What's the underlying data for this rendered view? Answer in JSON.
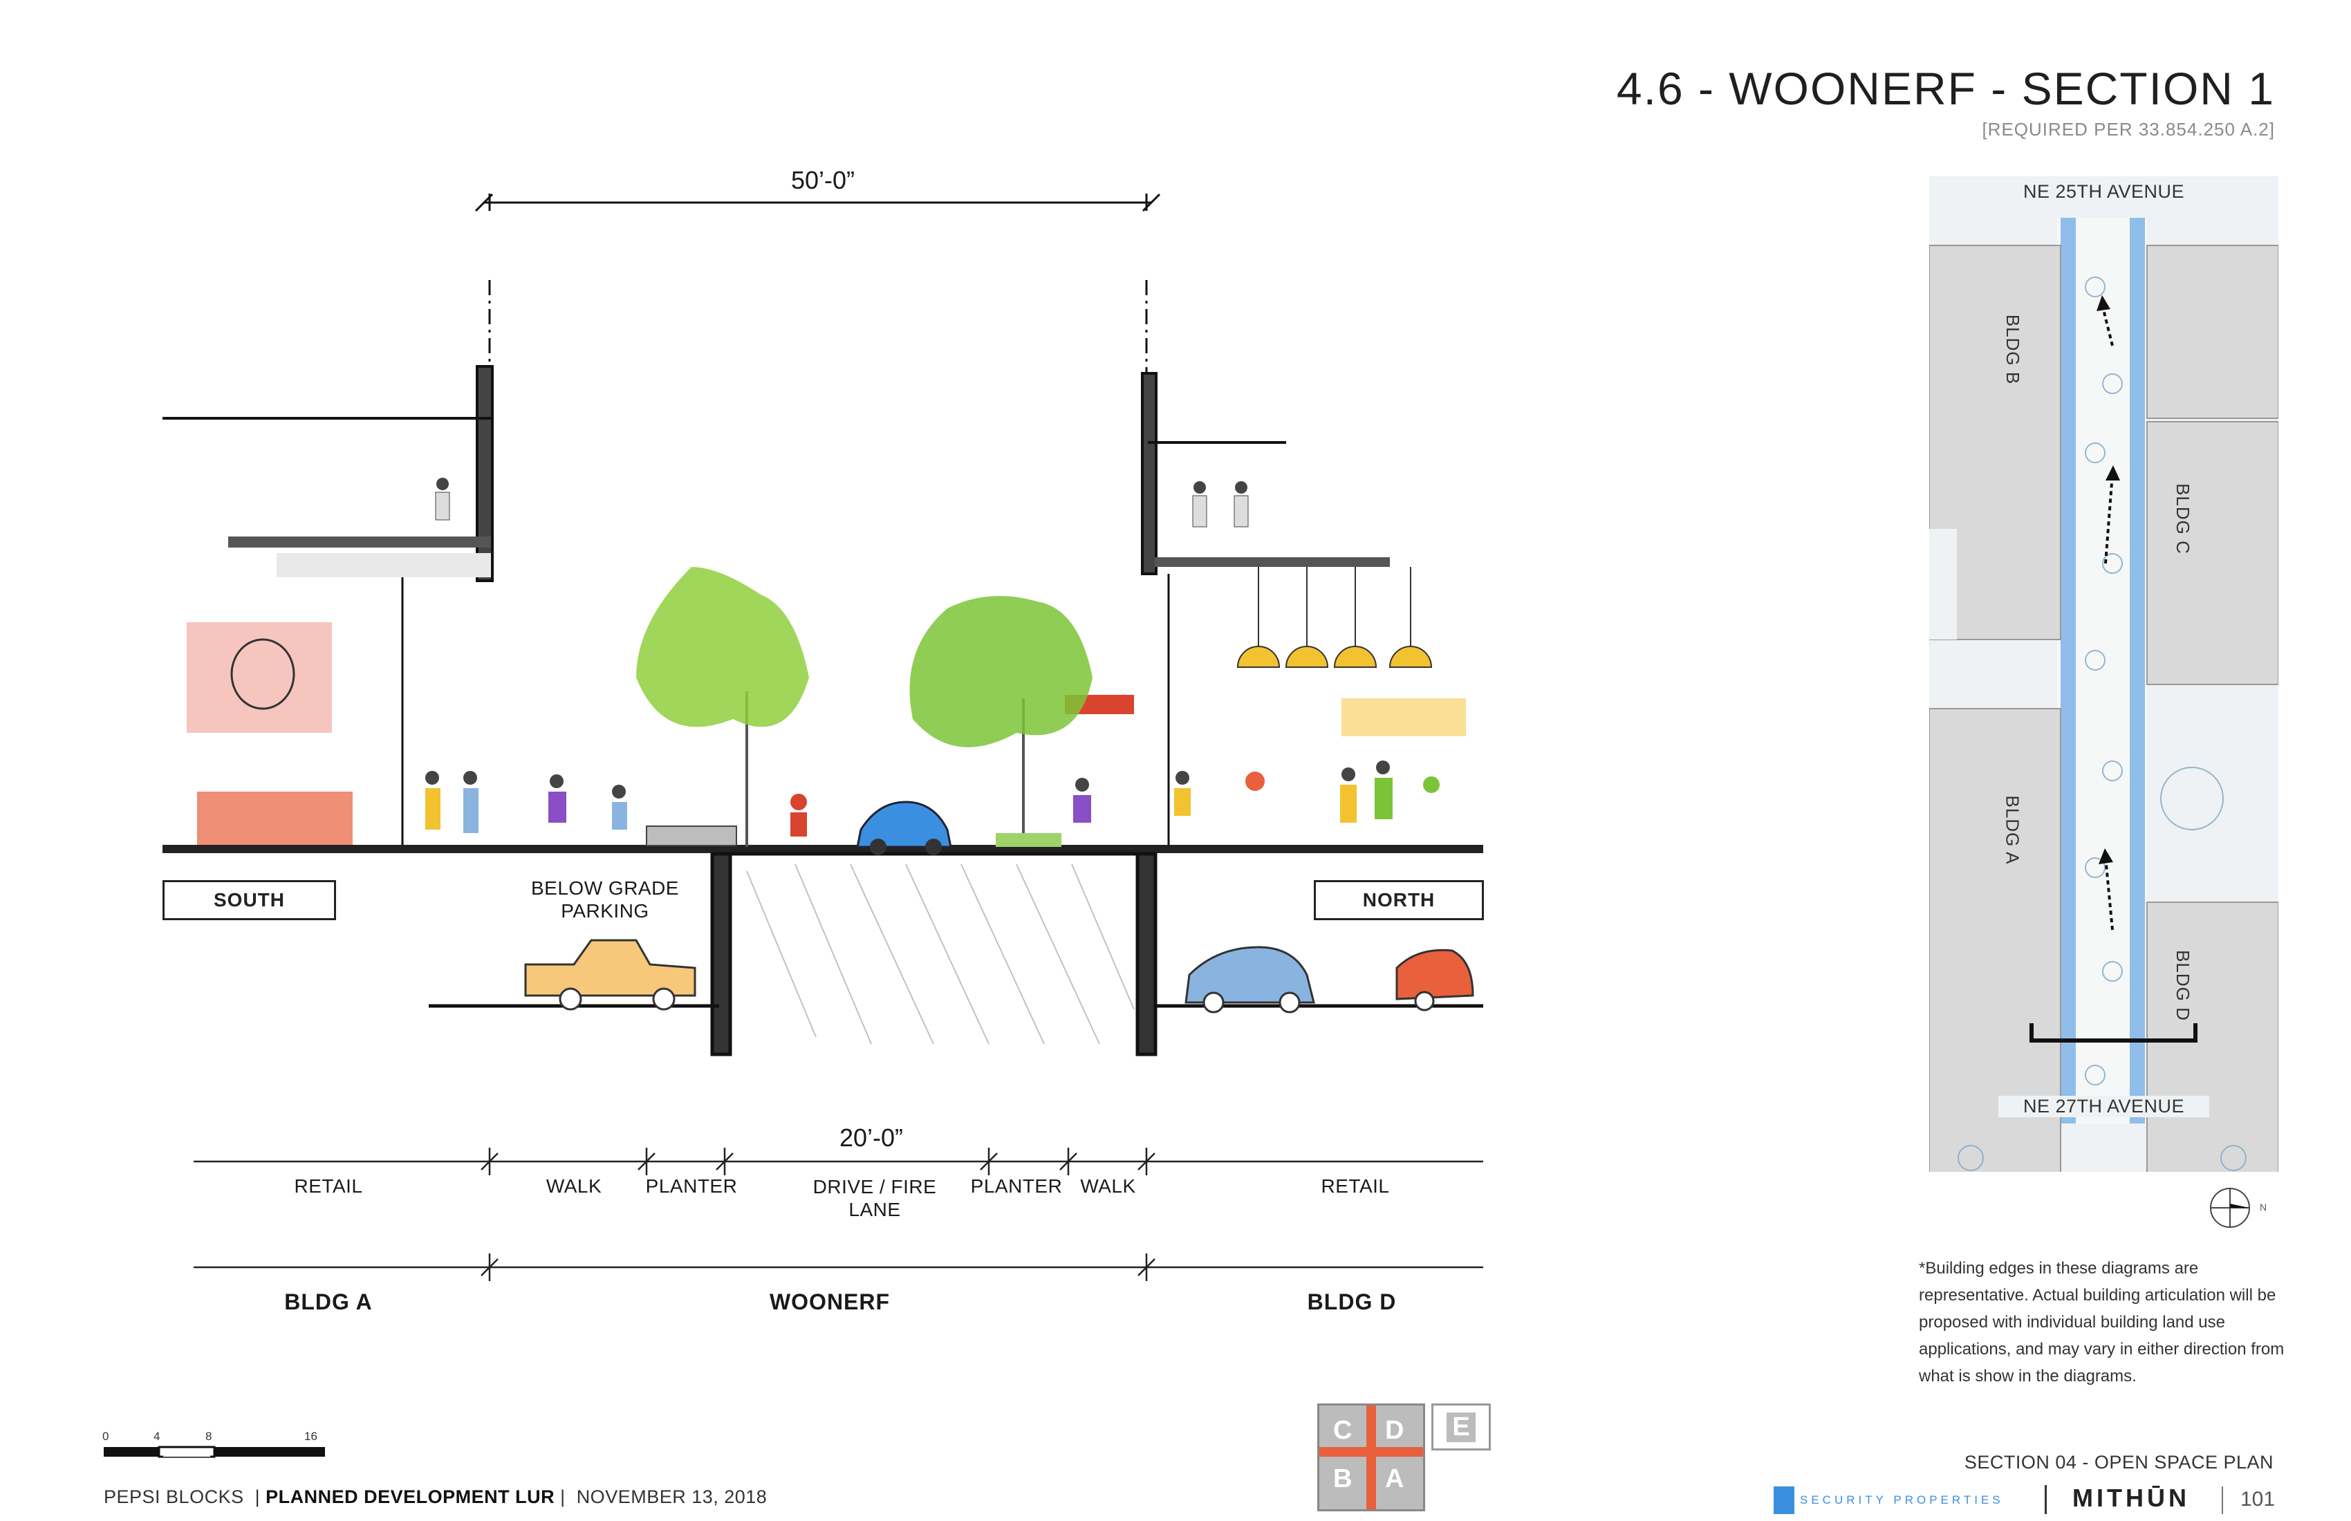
{
  "header": {
    "title": "4.6 - WOONERF - SECTION 1",
    "subtitle": "[REQUIRED PER 33.854.250 A.2]"
  },
  "section": {
    "total_width": "50’-0”",
    "woonerf_width": "20’-0”",
    "south_label": "SOUTH",
    "north_label": "NORTH",
    "below_grade": "BELOW GRADE\nPARKING",
    "zones": [
      "RETAIL",
      "WALK",
      "PLANTER",
      "DRIVE / FIRE\nLANE",
      "PLANTER",
      "WALK",
      "RETAIL"
    ],
    "groups": [
      "BLDG A",
      "WOONERF",
      "BLDG D"
    ]
  },
  "keyplan": {
    "street_top": "NE 25TH AVENUE",
    "street_bottom": "NE 27TH AVENUE",
    "buildings": [
      "BLDG B",
      "BLDG C",
      "BLDG A",
      "BLDG D"
    ],
    "north_arrow_letter": "N",
    "colors": {
      "water": "#3b8fe0",
      "building": "#d9d9d9"
    }
  },
  "note": "*Building edges in these diagrams are representative.  Actual building articulation will be proposed with individual building land use applications, and may vary in either direction from what is show in the diagrams.",
  "scale_bar": {
    "ticks": [
      "0",
      "4",
      "8",
      "16"
    ]
  },
  "block_key": {
    "letters": [
      "C",
      "D",
      "B",
      "A",
      "E"
    ],
    "highlight_color": "#e8603c"
  },
  "footer": {
    "project": "PEPSI BLOCKS",
    "document": "PLANNED DEVELOPMENT LUR",
    "date": "NOVEMBER 13, 2018",
    "section": "SECTION 04 - OPEN SPACE PLAN",
    "logo_security": "SECURITY PROPERTIES",
    "logo_mithun": "MITHŪN",
    "page": "101"
  }
}
